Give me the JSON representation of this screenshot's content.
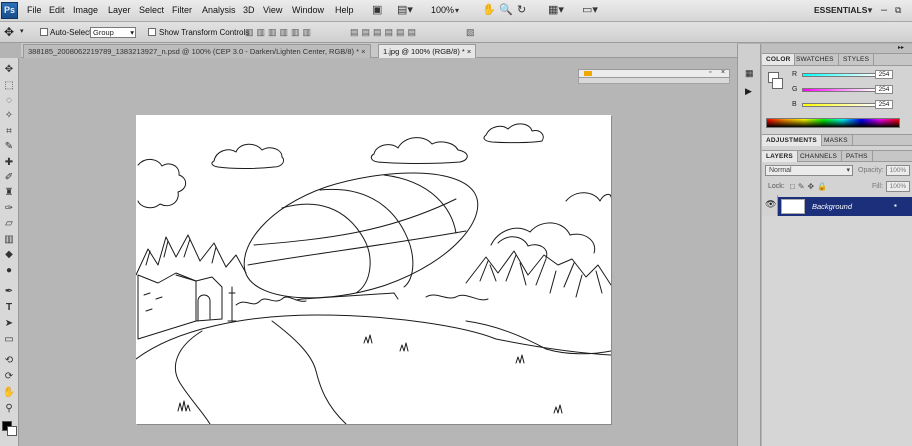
{
  "app": {
    "logo": "Ps",
    "workspace": "ESSENTIALS"
  },
  "menu": [
    "File",
    "Edit",
    "Image",
    "Layer",
    "Select",
    "Filter",
    "Analysis",
    "3D",
    "View",
    "Window",
    "Help"
  ],
  "zoom": "100%",
  "options": {
    "auto_select_label": "Auto-Select:",
    "auto_select_value": "Group",
    "transform_label": "Show Transform Controls"
  },
  "tabs": [
    {
      "label": "388185_2008062219789_1383213927_n.psd @ 100% (CEP 3.0 - Darken/Lighten Center, RGB/8) *",
      "active": false
    },
    {
      "label": "1.jpg @ 100% (RGB/8) *",
      "active": true
    }
  ],
  "panels": {
    "color_tabs": [
      "COLOR",
      "SWATCHES",
      "STYLES"
    ],
    "rgb": [
      {
        "label": "R",
        "value": "254"
      },
      {
        "label": "G",
        "value": "254"
      },
      {
        "label": "B",
        "value": "254"
      }
    ],
    "adj_tabs": [
      "ADJUSTMENTS",
      "MASKS"
    ],
    "layers_tabs": [
      "LAYERS",
      "CHANNELS",
      "PATHS"
    ],
    "blend_mode": "Normal",
    "opacity_label": "Opacity:",
    "opacity_value": "100%",
    "lock_label": "Lock:",
    "fill_label": "Fill:",
    "fill_value": "100%",
    "layer_name": "Background"
  },
  "icons": [
    "photoshop-logo",
    "hand-icon",
    "zoom-icon",
    "rotate-icon",
    "grid-icon",
    "screen-mode-icon",
    "move-tool-icon",
    "eye-icon",
    "lock-icon"
  ]
}
